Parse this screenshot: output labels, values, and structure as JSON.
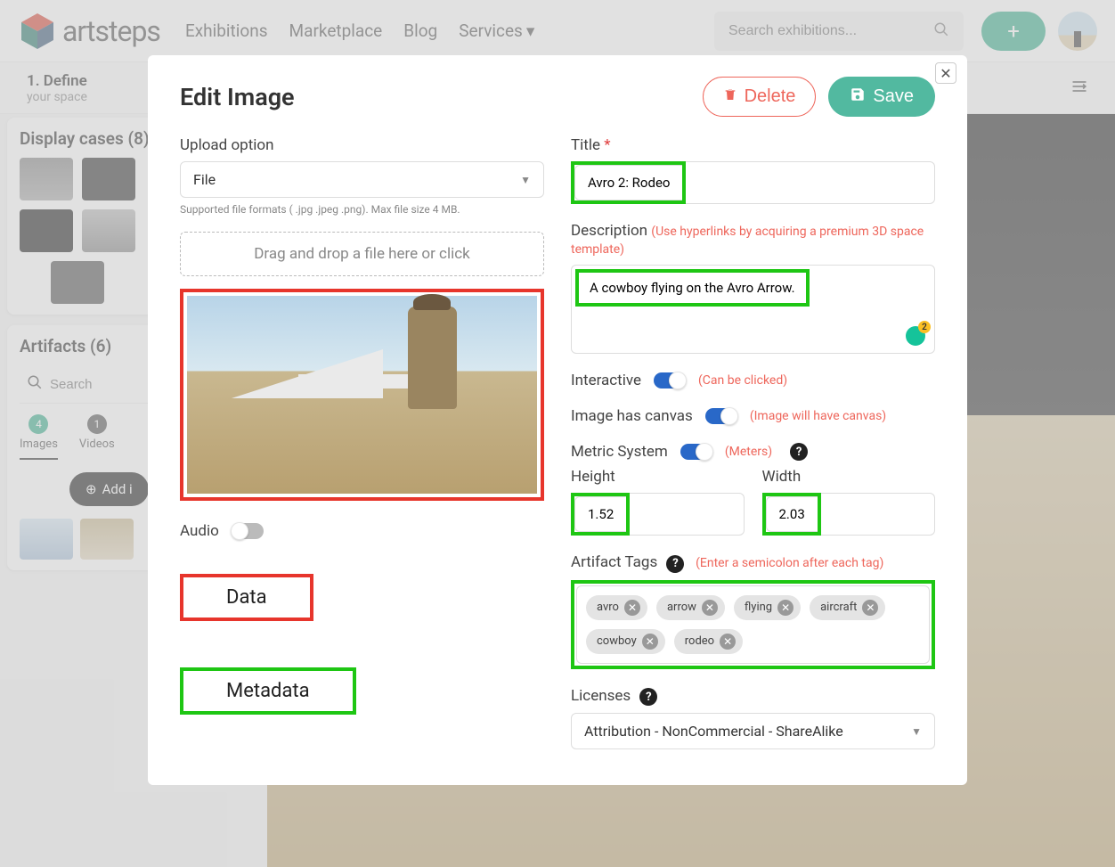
{
  "nav": {
    "brand": "artsteps",
    "links": [
      "Exhibitions",
      "Marketplace",
      "Blog",
      "Services"
    ],
    "search_placeholder": "Search exhibitions..."
  },
  "step": {
    "title": "1. Define",
    "sub": "your space"
  },
  "sidebar": {
    "display_cases_title": "Display cases (8)",
    "artifacts_title": "Artifacts (6)",
    "search_placeholder": "Search",
    "tabs": {
      "images": {
        "count": "4",
        "label": "Images"
      },
      "videos": {
        "count": "1",
        "label": "Videos"
      }
    },
    "add_item": "Add i"
  },
  "modal": {
    "title": "Edit Image",
    "delete": "Delete",
    "save": "Save",
    "upload_label": "Upload option",
    "upload_value": "File",
    "upload_hint": "Supported file formats ( .jpg .jpeg .png). Max file size 4 MB.",
    "dropzone": "Drag and drop a file here or click",
    "audio_label": "Audio",
    "data_annotation": "Data",
    "metadata_annotation": "Metadata",
    "title_label": "Title",
    "title_value": "Avro 2: Rodeo",
    "desc_label": "Description",
    "desc_hint": "(Use hyperlinks by acquiring a premium 3D space template)",
    "desc_value": "A cowboy flying on the Avro Arrow.",
    "interactive_label": "Interactive",
    "interactive_hint": "(Can be clicked)",
    "canvas_label": "Image has canvas",
    "canvas_hint": "(Image will have canvas)",
    "metric_label": "Metric System",
    "metric_hint": "(Meters)",
    "height_label": "Height",
    "width_label": "Width",
    "height_value": "1.52",
    "width_value": "2.03",
    "tags_label": "Artifact Tags",
    "tags_hint": "(Enter a semicolon after each tag)",
    "tags": [
      "avro",
      "arrow",
      "flying",
      "aircraft",
      "cowboy",
      "rodeo"
    ],
    "licenses_label": "Licenses",
    "licenses_value": "Attribution - NonCommercial - ShareAlike"
  }
}
